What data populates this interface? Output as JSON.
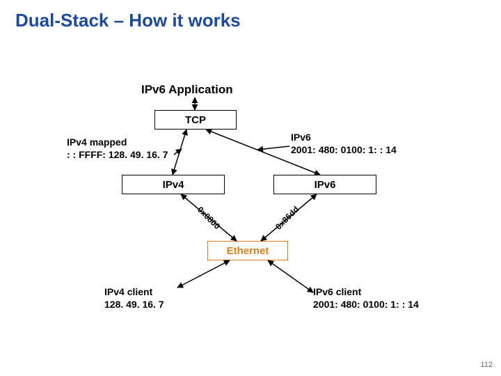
{
  "title": "Dual-Stack – How it works",
  "app_label": "IPv6 Application",
  "boxes": {
    "tcp": "TCP",
    "ipv4": "IPv4",
    "ipv6": "IPv6",
    "ethernet": "Ethernet"
  },
  "labels": {
    "mapped": "IPv4 mapped\n: : FFFF: 128. 49. 16. 7",
    "ipv6addr": "IPv6\n2001: 480: 0100: 1: : 14",
    "client4": "IPv4 client\n128. 49. 16. 7",
    "client6": "IPv6 client\n2001: 480: 0100: 1: : 14"
  },
  "proto": {
    "ipv4_ethertype": "0x0800",
    "ipv6_ethertype": "0x86dd"
  },
  "pagenum": "112"
}
